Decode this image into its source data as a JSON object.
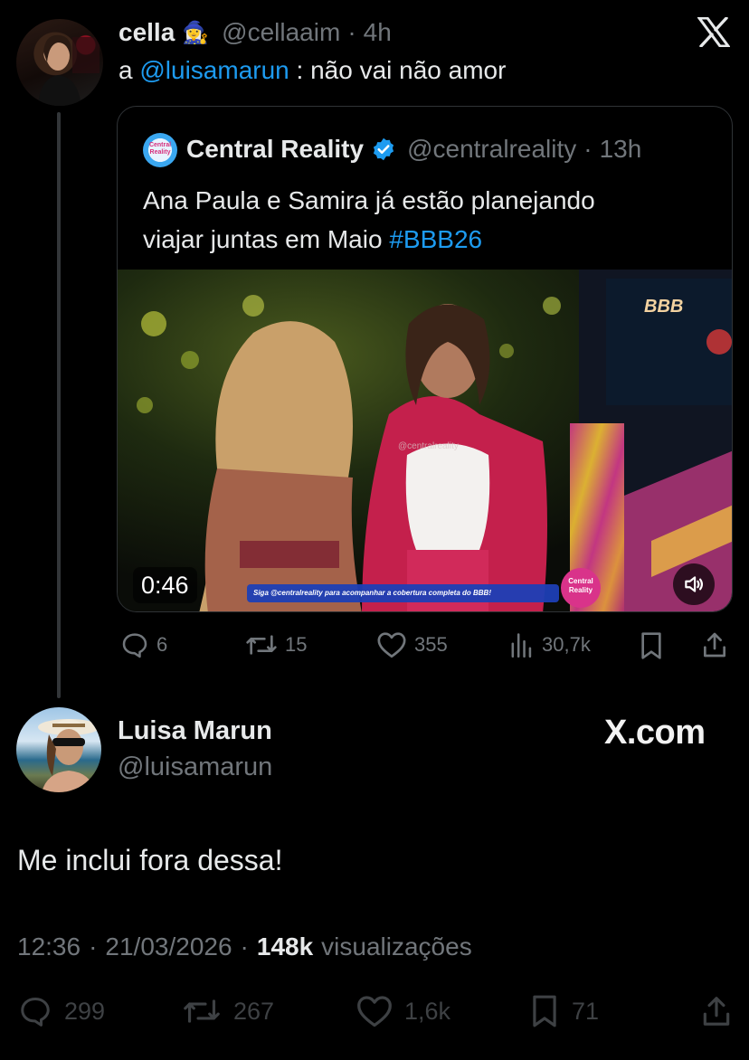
{
  "reply_tweet": {
    "author_name": "cella",
    "author_emoji": "🧙‍♀️",
    "handle": "@cellaaim",
    "separator": "·",
    "time": "4h",
    "text_prefix": "a",
    "mention": "@luisamarun",
    "text_suffix": ": não vai não amor"
  },
  "quoted_tweet": {
    "avatar_text": "Central Reality",
    "author_name": "Central Reality",
    "verified": true,
    "handle": "@centralreality",
    "separator": "·",
    "time": "13h",
    "text_line1": "Ana Paula e Samira já estão planejando",
    "text_line2_prefix": "viajar juntas em Maio",
    "hashtag": "#BBB26",
    "video": {
      "duration": "0:46",
      "logo": "BBB",
      "ticker": "Siga @centralreality para acompanhar a cobertura completa do BBB!",
      "watermark": "@centralreality",
      "badge": "Central Reality"
    }
  },
  "reply_actions": {
    "replies": "6",
    "retweets": "15",
    "likes": "355",
    "views": "30,7k"
  },
  "main_tweet": {
    "author_name": "Luisa Marun",
    "handle": "@luisamarun",
    "brand": "X.com",
    "text": "Me inclui fora dessa!",
    "time": "12:36",
    "separator": "·",
    "date": "21/03/2026",
    "views_count": "148k",
    "views_label": "visualizações"
  },
  "main_actions": {
    "replies": "299",
    "retweets": "267",
    "likes": "1,6k",
    "bookmarks": "71"
  },
  "colors": {
    "background": "#000000",
    "text": "#e7e9ea",
    "muted": "#71767b",
    "link": "#1d9bf0",
    "verified": "#1d9bf0"
  }
}
